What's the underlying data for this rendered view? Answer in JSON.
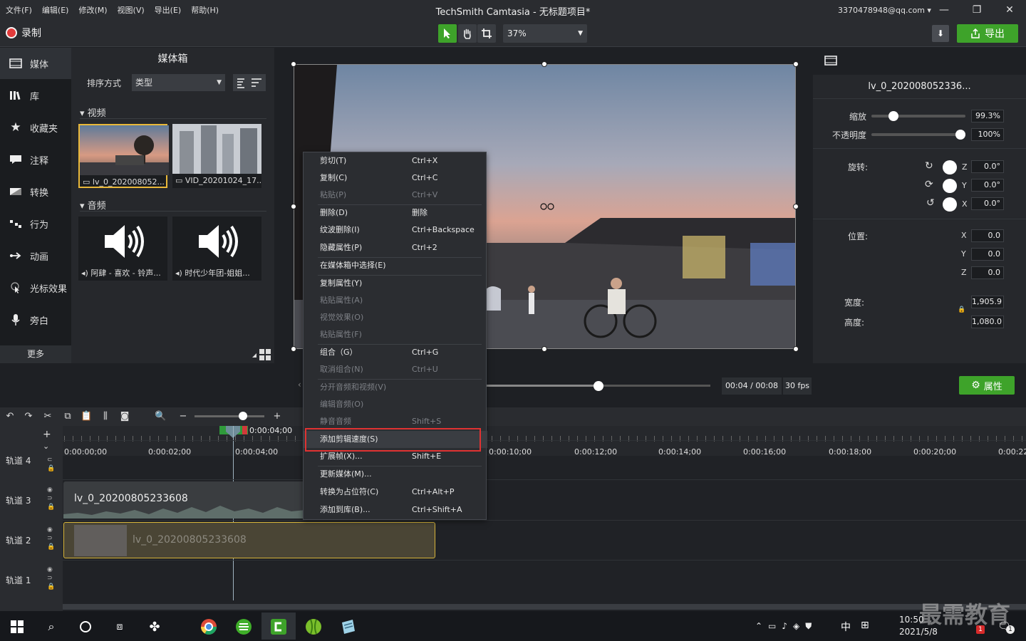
{
  "menu": [
    "文件(F)",
    "编辑(E)",
    "修改(M)",
    "视图(V)",
    "导出(E)",
    "帮助(H)"
  ],
  "app_title": "TechSmith Camtasia - 无标题项目*",
  "account": "3370478948@qq.com ▾",
  "window_controls": {
    "minimize": "—",
    "restore": "❐",
    "close": "✕"
  },
  "record_label": "录制",
  "zoom_value": "37%",
  "export_label": "导出",
  "nav": [
    {
      "label": "媒体",
      "icon": "media-icon"
    },
    {
      "label": "库",
      "icon": "library-icon"
    },
    {
      "label": "收藏夹",
      "icon": "star-icon"
    },
    {
      "label": "注释",
      "icon": "annotation-icon"
    },
    {
      "label": "转换",
      "icon": "transition-icon"
    },
    {
      "label": "行为",
      "icon": "behavior-icon"
    },
    {
      "label": "动画",
      "icon": "animation-icon"
    },
    {
      "label": "光标效果",
      "icon": "cursor-icon"
    },
    {
      "label": "旁白",
      "icon": "microphone-icon"
    }
  ],
  "more_label": "更多",
  "mediabin": {
    "title": "媒体箱",
    "sort_label": "排序方式",
    "sort_value": "类型",
    "video_section": "视频",
    "audio_section": "音频",
    "videos": [
      "lv_0_202008052...",
      "VID_20201024_17..."
    ],
    "audios": [
      "阿肆 - 喜欢 - 铃声...",
      "时代少年团-姐姐..."
    ]
  },
  "properties": {
    "clip_name": "lv_0_202008052336...",
    "scale_label": "缩放",
    "scale_value": "99.3%",
    "scale_level": 0.2,
    "opacity_label": "不透明度",
    "opacity_value": "100%",
    "opacity_level": 1.0,
    "rotation_label": "旋转:",
    "rotation": [
      {
        "axis": "Z",
        "value": "0.0°"
      },
      {
        "axis": "Y",
        "value": "0.0°"
      },
      {
        "axis": "X",
        "value": "0.0°"
      }
    ],
    "position_label": "位置:",
    "position": [
      {
        "axis": "X",
        "value": "0.0"
      },
      {
        "axis": "Y",
        "value": "0.0"
      },
      {
        "axis": "Z",
        "value": "0.0"
      }
    ],
    "width_label": "宽度:",
    "width_value": "1,905.9",
    "height_label": "高度:",
    "height_value": "1,080.0"
  },
  "playback": {
    "time": "00:04 / 00:08",
    "fps": "30 fps",
    "progress": 0.5
  },
  "properties_button": "属性",
  "timeline": {
    "playhead_time": "0:00:04;00",
    "ticks": [
      "0:00:00;00",
      "0:00:02;00",
      "0:00:04;00",
      "0:00:10;00",
      "0:00:12;00",
      "0:00:14;00",
      "0:00:16;00",
      "0:00:18;00",
      "0:00:20;00",
      "0:00:22"
    ],
    "tracks": [
      "轨道 4",
      "轨道 3",
      "轨道 2",
      "轨道 1"
    ],
    "audio_clip": "lv_0_20200805233608",
    "video_clip": "lv_0_20200805233608"
  },
  "context_menu": [
    {
      "label": "剪切(T)",
      "shortcut": "Ctrl+X",
      "disabled": false
    },
    {
      "label": "复制(C)",
      "shortcut": "Ctrl+C",
      "disabled": false
    },
    {
      "label": "粘贴(P)",
      "shortcut": "Ctrl+V",
      "disabled": true
    },
    {
      "label": "删除(D)",
      "shortcut": "删除",
      "disabled": false
    },
    {
      "label": "纹波删除(I)",
      "shortcut": "Ctrl+Backspace",
      "disabled": false
    },
    {
      "label": "隐藏属性(P)",
      "shortcut": "Ctrl+2",
      "disabled": false
    },
    {
      "label": "在媒体箱中选择(E)",
      "shortcut": "",
      "disabled": false
    },
    {
      "label": "复制属性(Y)",
      "shortcut": "",
      "disabled": false
    },
    {
      "label": "粘贴属性(A)",
      "shortcut": "",
      "disabled": true
    },
    {
      "label": "视觉效果(O)",
      "shortcut": "",
      "disabled": true
    },
    {
      "label": "粘贴属性(F)",
      "shortcut": "",
      "disabled": true
    },
    {
      "label": "组合（G）",
      "shortcut": "Ctrl+G",
      "disabled": false
    },
    {
      "label": "取消组合(N)",
      "shortcut": "Ctrl+U",
      "disabled": true
    },
    {
      "label": "分开音频和视频(V)",
      "shortcut": "",
      "disabled": true
    },
    {
      "label": "编辑音频(O)",
      "shortcut": "",
      "disabled": true
    },
    {
      "label": "静音音频",
      "shortcut": "Shift+S",
      "disabled": true
    },
    {
      "label": "添加剪辑速度(S)",
      "shortcut": "",
      "disabled": false
    },
    {
      "label": "扩展帧(X)...",
      "shortcut": "Shift+E",
      "disabled": false
    },
    {
      "label": "更新媒体(M)...",
      "shortcut": "",
      "disabled": false
    },
    {
      "label": "转换为占位符(C)",
      "shortcut": "Ctrl+Alt+P",
      "disabled": false
    },
    {
      "label": "添加到库(B)...",
      "shortcut": "Ctrl+Shift+A",
      "disabled": false
    }
  ],
  "taskbar": {
    "ime": "中",
    "time": "10:50",
    "date": "2021/5/8",
    "notif_count": "1",
    "action_count": "1"
  },
  "watermark": "最需教育",
  "colors": {
    "accent_green": "#3ea32a",
    "record_red": "#e23b3b",
    "highlight_red": "#e03232",
    "clip_border": "#d6b43a"
  }
}
